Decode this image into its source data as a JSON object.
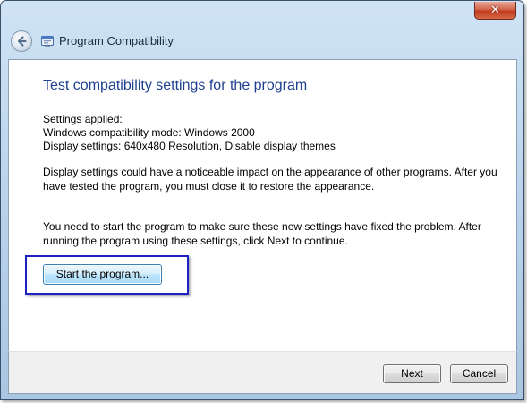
{
  "window": {
    "title": "Program Compatibility",
    "close_label": "✕"
  },
  "main": {
    "heading": "Test compatibility settings for the program",
    "settings_label": "Settings applied:",
    "compat_mode": "Windows compatibility mode: Windows 2000",
    "display_settings": "Display settings:  640x480 Resolution, Disable display themes",
    "notice_line1": "Display settings could have a noticeable impact on the appearance of other programs.  After you",
    "notice_line2": "have tested the program, you must close it to restore the appearance.",
    "instruction_line1": "You need to start the program to make sure these new settings have fixed the problem. After",
    "instruction_line2": "running the program using these settings, click Next to continue.",
    "start_button_label": "Start the program..."
  },
  "footer": {
    "next_label": "Next",
    "cancel_label": "Cancel"
  },
  "colors": {
    "heading": "#1f3f8f",
    "highlight_border": "#1d20c2",
    "close_button": "#c23a1e"
  },
  "icons": {
    "back": "back-arrow-icon",
    "app": "program-compatibility-icon",
    "close": "close-icon"
  }
}
